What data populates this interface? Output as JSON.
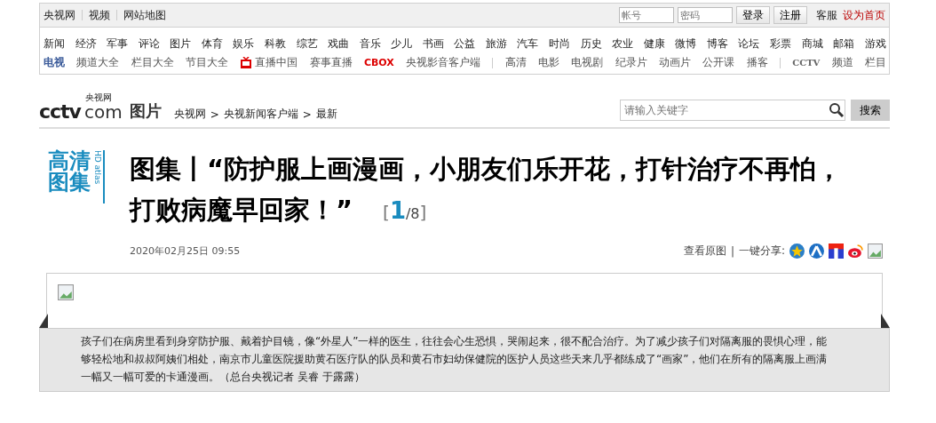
{
  "top_bar": {
    "links": [
      "央视网",
      "视频",
      "网站地图"
    ],
    "account": {
      "placeholder": "帐号"
    },
    "password": {
      "placeholder": "密码"
    },
    "buttons": [
      "登录",
      "注册"
    ],
    "right_links": [
      {
        "label": "客服",
        "highlight": false
      },
      {
        "label": "设为首页",
        "highlight": true
      }
    ]
  },
  "nav_main": [
    "新闻",
    "经济",
    "军事",
    "评论",
    "图片",
    "体育",
    "娱乐",
    "科教",
    "综艺",
    "戏曲",
    "音乐",
    "少儿",
    "书画",
    "公益",
    "旅游",
    "汽车",
    "时尚",
    "历史",
    "农业",
    "健康",
    "微博",
    "博客",
    "论坛",
    "彩票",
    "商城",
    "邮箱",
    "游戏"
  ],
  "nav_tv": [
    {
      "kind": "label",
      "label": "电视"
    },
    {
      "kind": "link",
      "label": "频道大全"
    },
    {
      "kind": "link",
      "label": "栏目大全"
    },
    {
      "kind": "link",
      "label": "节目大全"
    },
    {
      "kind": "live",
      "label": "直播中国"
    },
    {
      "kind": "link",
      "label": "赛事直播"
    },
    {
      "kind": "logo",
      "label": "CBOX"
    },
    {
      "kind": "link",
      "label": "央视影音客户端"
    },
    {
      "kind": "divider"
    },
    {
      "kind": "link",
      "label": "高清"
    },
    {
      "kind": "link",
      "label": "电影"
    },
    {
      "kind": "link",
      "label": "电视剧"
    },
    {
      "kind": "link",
      "label": "纪录片"
    },
    {
      "kind": "link",
      "label": "动画片"
    },
    {
      "kind": "link",
      "label": "公开课"
    },
    {
      "kind": "link",
      "label": "播客"
    },
    {
      "kind": "divider"
    },
    {
      "kind": "logo",
      "label": "CCTV"
    },
    {
      "kind": "link",
      "label": "频道"
    },
    {
      "kind": "link",
      "label": "栏目"
    }
  ],
  "header": {
    "logo": {
      "brand": "cctv",
      "domain": "com",
      "cn": "央视网",
      "section": "图片"
    },
    "breadcrumb": [
      "央视网",
      "央视新闻客户端",
      "最新"
    ],
    "separator": ">",
    "search": {
      "placeholder": "请输入关键字",
      "button": "搜索"
    }
  },
  "article": {
    "badge": {
      "line1": "高清",
      "line2": "图集",
      "en": "HD atlas"
    },
    "title_lines": [
      "图集丨“防护服上画漫画，小朋友们乐开花，打针治疗不再怕，",
      "打败病魔早回家！”"
    ],
    "counter": {
      "open": "[",
      "current": "1",
      "total": "/8",
      "close": "]"
    },
    "date": "2020年02月25日  09:55",
    "view_original": "查看原图",
    "divider": "|",
    "share_label": "一键分享:"
  },
  "gallery": {
    "caption": "孩子们在病房里看到身穿防护服、戴着护目镜，像“外星人”一样的医生，往往会心生恐惧，哭闹起来，很不配合治疗。为了减少孩子们对隔离服的畏惧心理，能够轻松地和叔叔阿姨们相处，南京市儿童医院援助黄石医疗队的队员和黄石市妇幼保健院的医护人员这些天来几乎都练成了“画家”，他们在所有的隔离服上画满一幅又一幅可爱的卡通漫画。（总台央视记者 吴睿 于露露）"
  }
}
